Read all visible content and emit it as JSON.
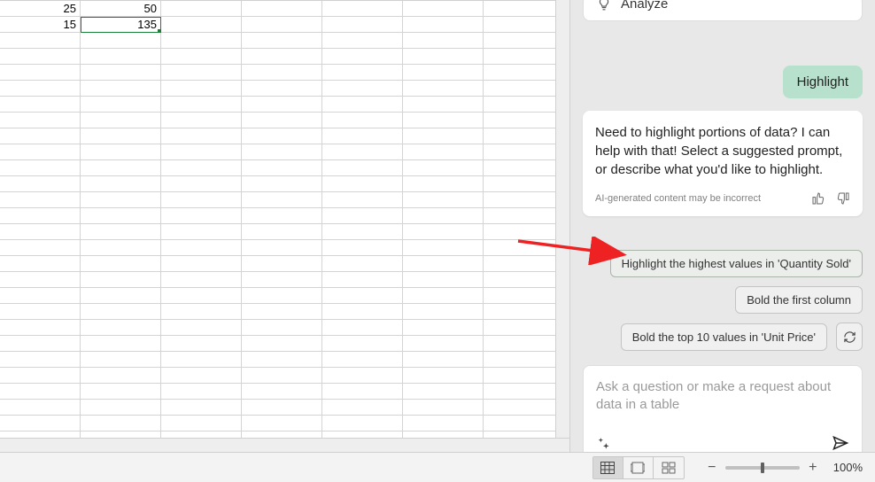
{
  "sheet": {
    "visible_cells": [
      {
        "row": 0,
        "col": 0,
        "value": "25"
      },
      {
        "row": 0,
        "col": 1,
        "value": "50"
      },
      {
        "row": 1,
        "col": 0,
        "value": "15"
      },
      {
        "row": 1,
        "col": 1,
        "value": "135",
        "selected": true
      }
    ],
    "rows": 28,
    "cols": 7
  },
  "copilot": {
    "analyze_label": "Analyze",
    "user_prompt": "Highlight",
    "response_text": "Need to highlight portions of data? I can help with that! Select a suggested prompt, or describe what you'd like to highlight.",
    "ai_note": "AI-generated content may be incorrect",
    "suggestions": [
      "Highlight the highest values in 'Quantity Sold'",
      "Bold the first column",
      "Bold the top 10 values in 'Unit Price'"
    ],
    "input_placeholder": "Ask a question or make a request about data in a table"
  },
  "statusbar": {
    "zoom_level": "100%"
  }
}
